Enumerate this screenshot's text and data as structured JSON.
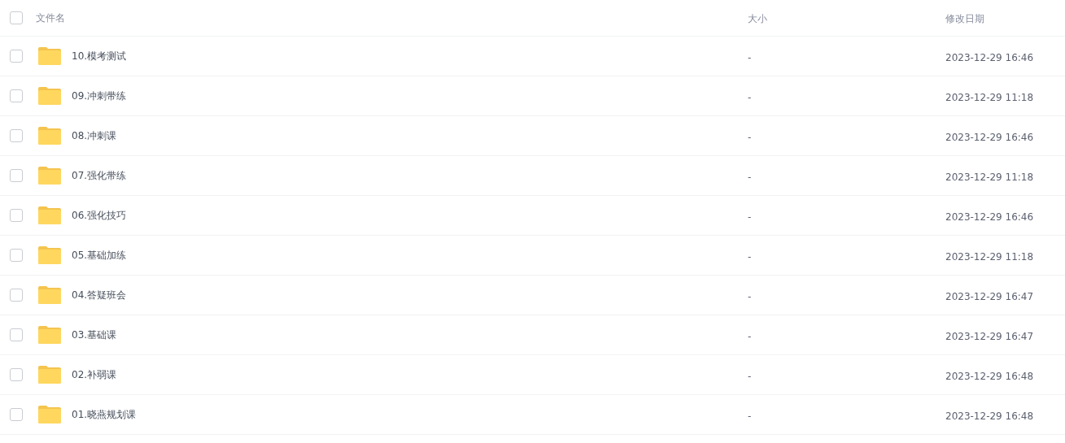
{
  "header": {
    "select_all_checked": false,
    "columns": [
      "文件名",
      "大小",
      "修改日期"
    ]
  },
  "rows": [
    {
      "name": "10.模考测试",
      "size": "-",
      "modified": "2023-12-29 16:46",
      "checked": false,
      "kind": "folder"
    },
    {
      "name": "09.冲刺带练",
      "size": "-",
      "modified": "2023-12-29 11:18",
      "checked": false,
      "kind": "folder"
    },
    {
      "name": "08.冲刺课",
      "size": "-",
      "modified": "2023-12-29 16:46",
      "checked": false,
      "kind": "folder"
    },
    {
      "name": "07.强化带练",
      "size": "-",
      "modified": "2023-12-29 11:18",
      "checked": false,
      "kind": "folder"
    },
    {
      "name": "06.强化技巧",
      "size": "-",
      "modified": "2023-12-29 16:46",
      "checked": false,
      "kind": "folder"
    },
    {
      "name": "05.基础加练",
      "size": "-",
      "modified": "2023-12-29 11:18",
      "checked": false,
      "kind": "folder"
    },
    {
      "name": "04.答疑班会",
      "size": "-",
      "modified": "2023-12-29 16:47",
      "checked": false,
      "kind": "folder"
    },
    {
      "name": "03.基础课",
      "size": "-",
      "modified": "2023-12-29 16:47",
      "checked": false,
      "kind": "folder"
    },
    {
      "name": "02.补弱课",
      "size": "-",
      "modified": "2023-12-29 16:48",
      "checked": false,
      "kind": "folder"
    },
    {
      "name": "01.晓燕规划课",
      "size": "-",
      "modified": "2023-12-29 16:48",
      "checked": false,
      "kind": "folder"
    }
  ]
}
